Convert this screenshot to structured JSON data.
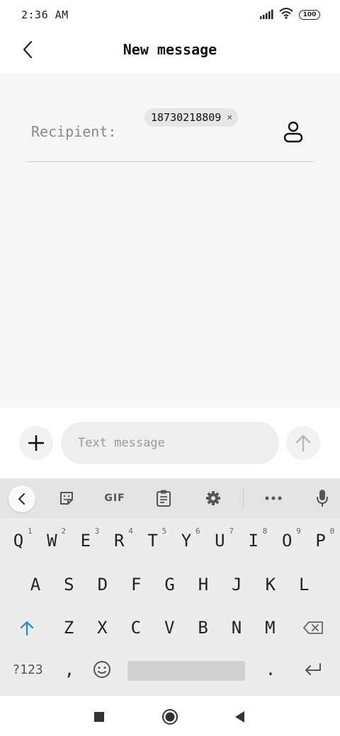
{
  "status_bar": {
    "time": "2:36 AM",
    "battery": "100",
    "icons": [
      "signal-icon",
      "wifi-icon",
      "battery-icon"
    ]
  },
  "header": {
    "title": "New message",
    "back_icon": "back-arrow-icon"
  },
  "recipient": {
    "label": "Recipient:",
    "chip_value": "18730218809",
    "chip_close": "×",
    "contact_icon": "contact-person-icon"
  },
  "compose": {
    "placeholder": "Text message",
    "add_icon": "plus-icon",
    "send_icon": "send-arrow-icon"
  },
  "keyboard": {
    "toolbar": [
      "collapse-chevron-icon",
      "sticker-icon",
      "gif",
      "clipboard-icon",
      "gear-icon",
      "more-icon",
      "mic-icon"
    ],
    "gif_label": "GIF",
    "row1": [
      "Q",
      "W",
      "E",
      "R",
      "T",
      "Y",
      "U",
      "I",
      "O",
      "P"
    ],
    "row1_hints": [
      "1",
      "2",
      "3",
      "4",
      "5",
      "6",
      "7",
      "8",
      "9",
      "0"
    ],
    "row2": [
      "A",
      "S",
      "D",
      "F",
      "G",
      "H",
      "J",
      "K",
      "L"
    ],
    "row3": [
      "Z",
      "X",
      "C",
      "V",
      "B",
      "N",
      "M"
    ],
    "symbols_label": "?123",
    "comma": ",",
    "period": ".",
    "accent_color": "#1a8ae6"
  },
  "navbar": {
    "icons": [
      "recents-square-icon",
      "home-circle-icon",
      "back-triangle-icon"
    ]
  }
}
